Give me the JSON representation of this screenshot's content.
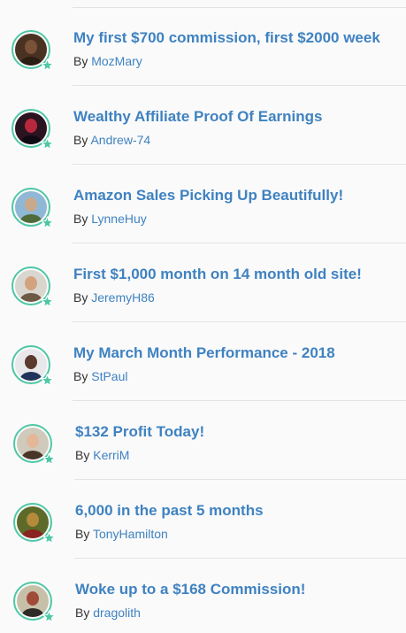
{
  "posts": [
    {
      "title": "My first $700 commission, first $2000 week",
      "by_label": "By",
      "author": "MozMary",
      "avatar_icon": "user-avatar",
      "avatar_colors": [
        "#4a3222",
        "#7a5238",
        "#2b1d14"
      ]
    },
    {
      "title": "Wealthy Affiliate Proof Of Earnings",
      "by_label": "By",
      "author": "Andrew-74",
      "avatar_icon": "user-avatar",
      "avatar_colors": [
        "#2a1420",
        "#b8283c",
        "#0f0a14"
      ]
    },
    {
      "title": "Amazon Sales Picking Up Beautifully!",
      "by_label": "By",
      "author": "LynneHuy",
      "avatar_icon": "user-avatar",
      "avatar_colors": [
        "#8fb7d6",
        "#caa98a",
        "#4f6b3a"
      ]
    },
    {
      "title": "First $1,000 month on 14 month old site!",
      "by_label": "By",
      "author": "JeremyH86",
      "avatar_icon": "user-avatar",
      "avatar_colors": [
        "#d9d6cf",
        "#d3a37f",
        "#6d5a46"
      ]
    },
    {
      "title": "My March Month Performance - 2018",
      "by_label": "By",
      "author": "StPaul",
      "avatar_icon": "user-avatar",
      "avatar_colors": [
        "#e8e8ea",
        "#5a3a2c",
        "#20335a"
      ]
    },
    {
      "title": "$132 Profit Today!",
      "by_label": "By",
      "author": "KerriM",
      "avatar_icon": "user-avatar",
      "avatar_colors": [
        "#cfcabb",
        "#e2b899",
        "#4a3628"
      ]
    },
    {
      "title": "6,000 in the past 5 months",
      "by_label": "By",
      "author": "TonyHamilton",
      "avatar_icon": "user-avatar",
      "avatar_colors": [
        "#5d6a2a",
        "#b58a3a",
        "#8a2420"
      ]
    },
    {
      "title": "Woke up to a $168 Commission!",
      "by_label": "By",
      "author": "dragolith",
      "avatar_icon": "user-avatar",
      "avatar_colors": [
        "#c7c0a8",
        "#a04a3a",
        "#2d2a28"
      ]
    }
  ],
  "colors": {
    "link": "#3f82c1",
    "avatar_ring": "#4fc7a6",
    "star_badge": "#4fc7a6",
    "divider": "#e3e3e3",
    "text": "#333333",
    "background": "#fafafa"
  }
}
